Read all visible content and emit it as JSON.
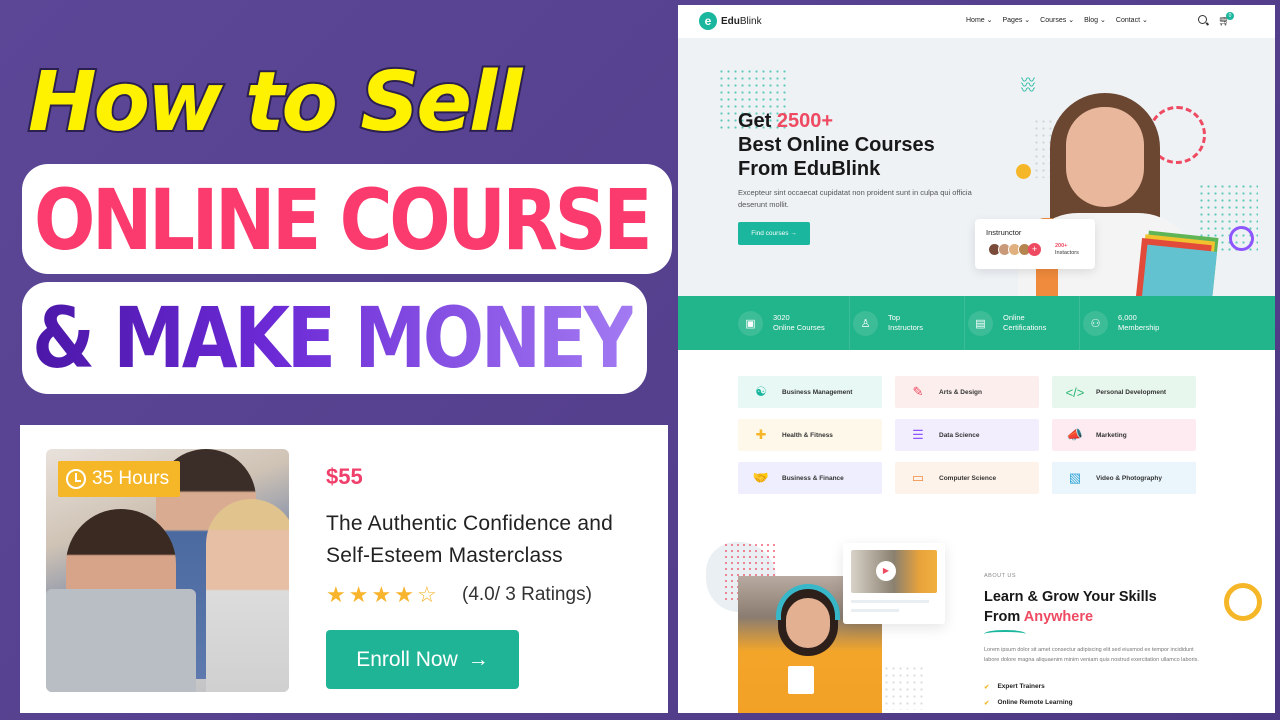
{
  "thumbnail": {
    "headline_line1": "How to Sell",
    "headline_line2": "ONLINE COURSE",
    "headline_line3": "& MAKE MONEY",
    "colors": {
      "background": "#5a4692",
      "yellow": "#fff200",
      "pink": "#fb3a6d",
      "purple": "#6c2ad6"
    }
  },
  "course_card": {
    "duration_badge": "35 Hours",
    "price": "$55",
    "title": "The Authentic Confidence and Self-Esteem Masterclass",
    "rating_value": 4.0,
    "rating_max": 5,
    "stars": [
      "★",
      "★",
      "★",
      "★",
      "☆"
    ],
    "ratings_text": "(4.0/ 3 Ratings)",
    "enroll_label": "Enroll Now",
    "enroll_arrow": "→",
    "colors": {
      "badge": "#f5b728",
      "price": "#ef3f6a",
      "button": "#20b496"
    }
  },
  "website": {
    "brand_mark": "e",
    "brand_bold": "Edu",
    "brand_light": "Blink",
    "nav": [
      "Home",
      "Pages",
      "Courses",
      "Blog",
      "Contact"
    ],
    "cart_count": "0",
    "hero": {
      "title_prefix": "Get ",
      "title_accent": "2500+",
      "title_line2": "Best Online Courses",
      "title_line3": "From EduBlink",
      "description": "Excepteur sint occaecat cupidatat non proident sunt in culpa qui officia deserunt mollit.",
      "cta": "Find courses →",
      "instructor_card": {
        "label": "Instrunctor",
        "plus": "+",
        "count": "200+",
        "count_label": "Instactors"
      }
    },
    "stats": [
      {
        "icon": "laptop-icon",
        "glyph": "▣",
        "line1": "3020",
        "line2": "Online Courses"
      },
      {
        "icon": "instructor-icon",
        "glyph": "♙",
        "line1": "Top",
        "line2": "Instructors"
      },
      {
        "icon": "certificate-icon",
        "glyph": "▤",
        "line1": "Online",
        "line2": "Certifications"
      },
      {
        "icon": "members-icon",
        "glyph": "⚇",
        "line1": "6,000",
        "line2": "Membership"
      }
    ],
    "categories": [
      {
        "label": "Business Management",
        "glyph": "☯",
        "color": "#1ab69d",
        "bg": "#e7f8f5"
      },
      {
        "label": "Arts & Design",
        "glyph": "✎",
        "color": "#ee4a62",
        "bg": "#fdeeee"
      },
      {
        "label": "Personal Development",
        "glyph": "</>",
        "color": "#2bb673",
        "bg": "#e8f7ee"
      },
      {
        "label": "Health & Fitness",
        "glyph": "✚",
        "color": "#f5b728",
        "bg": "#fef8ea"
      },
      {
        "label": "Data Science",
        "glyph": "☰",
        "color": "#8e56ff",
        "bg": "#f3eefe"
      },
      {
        "label": "Marketing",
        "glyph": "📣",
        "color": "#f0437d",
        "bg": "#fdebf1"
      },
      {
        "label": "Business & Finance",
        "glyph": "🤝",
        "color": "#6a5af9",
        "bg": "#eeeefe"
      },
      {
        "label": "Computer Science",
        "glyph": "▭",
        "color": "#f08a3c",
        "bg": "#fef3ea"
      },
      {
        "label": "Video & Photography",
        "glyph": "▧",
        "color": "#35a6d8",
        "bg": "#eaf6fc"
      }
    ],
    "about": {
      "eyebrow": "ABOUT US",
      "title_line1": "Learn & Grow Your Skills",
      "title_prefix": "From ",
      "title_accent": "Anywhere",
      "description": "Lorem ipsum dolor sit amet consectur adipiscing elit sed eiusmod ex tempor incididunt labore dolore magna aliquaenim minim veniam quis nostrud exercitation ullamco laboris.",
      "checklist": [
        "Expert Trainers",
        "Online Remote Learning"
      ],
      "check_glyph": "✔",
      "play_glyph": "▶"
    },
    "colors": {
      "primary": "#1ab69d",
      "accent": "#ee4a62",
      "stats_bar": "#22b48a"
    }
  }
}
